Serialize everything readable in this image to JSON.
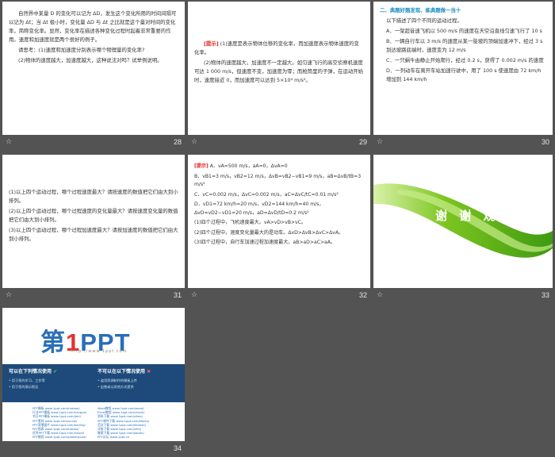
{
  "slides": {
    "s28": {
      "number": "28",
      "paragraphs": [
        "自然界中某量 D 的变化可以记为 ΔD，发生这个变化所用的时间间隔可以记为 Δt；当 Δt 极小时，变化量 ΔD 与 Δt 之比就是这个量对时间的变化率，简称变化率。显然，变化率在描述各种变化过程时起着非常重要的作用。速度和加速度就是两个很好的例子。",
        "请思考：(1)速度和加速度分别表示哪个物理量的变化率?",
        "(2)物体的速度越大，加速度越大，这种说法对吗？试举例说明。"
      ]
    },
    "s29": {
      "number": "29",
      "tag": "[提示]",
      "paragraphs": [
        "(1)速度是表示物体位移的变化率，而加速度表示物体速度的变化率。",
        "(2)物体的速度越大，加速度不一定越大。如匀速飞行的高空侦察机速度可达 1 000 m/s，但速度不变，加速度为零；而枪筒里的子弹，在运动开始时，速度接近 0，而加速度可以达到 5×10⁴ m/s²。"
      ]
    },
    "s30": {
      "number": "30",
      "heading": "二、典题好题发现、练典题做一当十",
      "intro": "以下描述了四个不同的运动过程。",
      "items": [
        "A．一架超音速飞机以 500 m/s 的速度在天空沿直线匀速飞行了 10 s",
        "B．一辆自行车以 3 m/s 的速度从某一陡坡的顶端加速冲下，经过 3 s 到达坡路底端时，速度变为 12 m/s",
        "C．一只蜗牛由静止开始爬行，经过 0.2 s，获得了 0.002 m/s 的速度",
        "D．一列动车在离开车站加速行驶中，用了 100 s 使速度由 72 km/h 增加到 144 km/h"
      ]
    },
    "s31": {
      "number": "31",
      "paragraphs": [
        "(1)以上四个运动过程，哪个过程速度最大？请按速度的数值把它们由大到小排列。",
        "(2)以上四个运动过程，哪个过程速度的变化量最大？请按速度变化量的数值把它们由大到小排列。",
        "(3)以上四个运动过程，哪个过程加速度最大？请按加速度的数值把它们由大到小排列。"
      ]
    },
    "s32": {
      "number": "32",
      "tag": "[提示]",
      "lines": [
        "A．vA=500 m/s，aA=0，ΔvA=0",
        "B．vB1=3 m/s，vB2=12 m/s，ΔvB=vB2−vB1=9 m/s，aB=ΔvB/tB=3 m/s²",
        "C．vC=0.002 m/s，ΔvC=0.002 m/s，aC=ΔvC/tC=0.01 m/s²",
        "D．vD1=72 km/h=20 m/s，vD2=144 km/h=40 m/s，ΔvD=vD2−vD1=20 m/s，aD=ΔvD/tD=0.2 m/s²",
        "(1)四个过程中，飞机速度最大。vA>vD>vB>vC。",
        "(2)四个过程中，速度变化量最大的是动车。ΔvD>ΔvB>ΔvC>ΔvA。",
        "(3)四个过程中，自行车加速过程加速度最大。aB>aD>aC>aA。"
      ]
    },
    "s33": {
      "number": "33",
      "thanks": "谢 谢 观 看"
    },
    "s34": {
      "number": "34",
      "logo_main": "第",
      "logo_one": "1",
      "logo_tail": "PPT",
      "url": "http://www.1ppt.com",
      "allowed_title": "可以在下列情况使用",
      "allowed_lines": [
        "• 用于您的学习，工作等",
        "• 用于您的演示报告"
      ],
      "forbidden_title": "不可以在以下情况使用",
      "forbidden_lines": [
        "• 盗用资源制作的模板上传",
        "• 出售或以其他方式提供"
      ],
      "links_left": [
        "PPT模板 www.1ppt.com/moban/",
        "行业PPT模板 www.1ppt.com/hangye/",
        "节日PPT模板 www.1ppt.com/jieri/",
        "PPT素材 www.1ppt.com/sucai/",
        "PPT背景图片 www.1ppt.com/beijing/",
        "PPT图表 www.1ppt.com/tubiao/",
        "优秀PPT下载 www.1ppt.com/xiazai/",
        "PPT教程 www.1ppt.com/powerpoint/"
      ],
      "links_right": [
        "Word教程 www.1ppt.com/word/",
        "Excel教程 www.1ppt.com/excel/",
        "资料下载 www.1ppt.com/ziliao/",
        "PPT课件下载 www.1ppt.com/kejian/",
        "范文下载 www.1ppt.com/fanwen/",
        "试卷下载 www.1ppt.com/shiti/",
        "教案下载 www.1ppt.com/jiaoan/",
        "PPT论坛 www.1ppt.cn"
      ]
    }
  },
  "footer_star": "☆",
  "colors": {
    "background": "#535353",
    "accent": "#1a8fc2",
    "tag": "#dd2222",
    "green": "#7cc521"
  }
}
